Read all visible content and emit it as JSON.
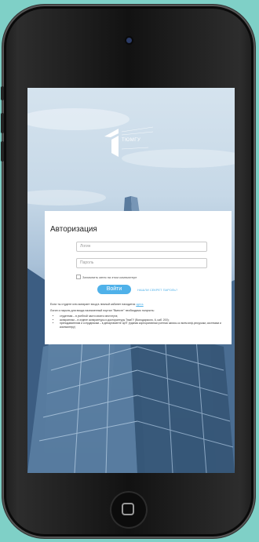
{
  "login_card": {
    "title": "Авторизация",
    "login_placeholder": "Логин",
    "password_placeholder": "Пароль",
    "remember_label": "Запомнить меня на этом компьютере",
    "login_button": "Войти",
    "forgot_link": "НАШЛИ СЕКРЕТ ПАРОЛЬ?",
    "note_prefix": "Если ты студент или аспирант вход в личный кабинет находится",
    "note_link": "здесь",
    "info_text": "Логин и пароль для входа назначенный портал \"Вместе\" необходимо получить:",
    "bullets": [
      "студентам – в учебной части своего института;",
      "аспирантам – в отделе аспирантуры и докторантуры ТюмГУ (Володарского, 6, каб. 200);",
      "преподавателям и сотрудникам – в департаменте ЦИТ (единая корпоративная учетная запись ко всем инф.ресурсам, системам и компьютеру)"
    ]
  },
  "logo": {
    "text": "ТЮМГУ"
  },
  "colors": {
    "background": "#7fd0c7",
    "accent": "#4fb1e9",
    "card": "#ffffff"
  },
  "icons": {
    "camera": "front-camera-icon",
    "home": "home-square-icon"
  }
}
